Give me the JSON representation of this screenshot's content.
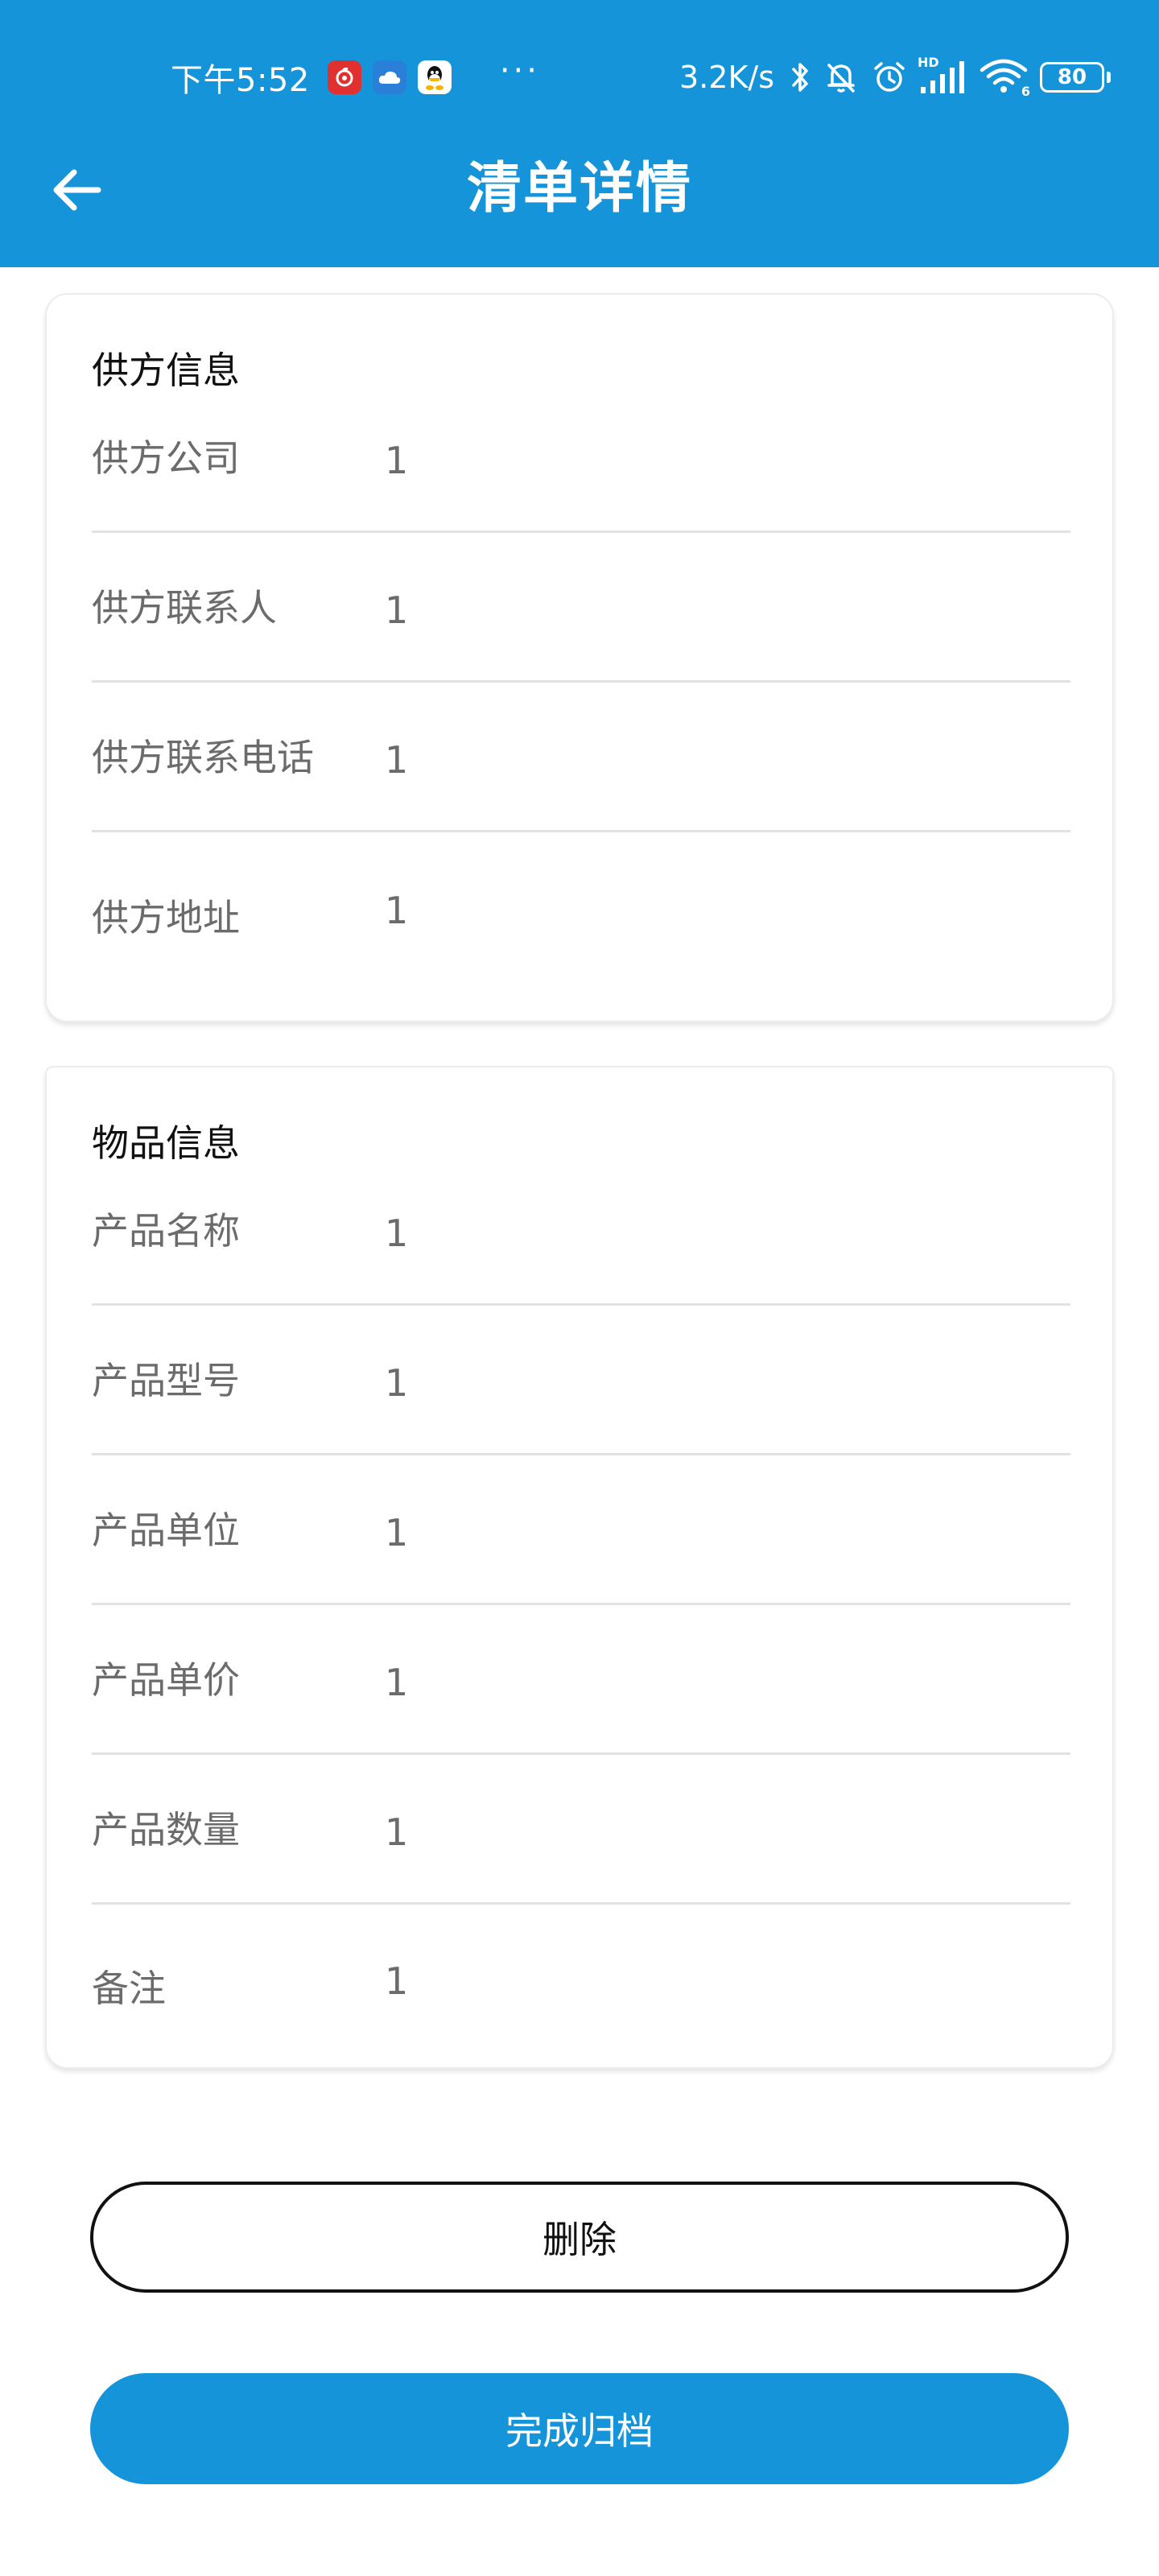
{
  "status_bar": {
    "time": "下午5:52",
    "network_speed": "3.2K/s",
    "battery_level": "80",
    "signal_label": "HD",
    "wifi_label": "6",
    "icons": [
      "netease-music-icon",
      "cloud-icon",
      "qq-icon",
      "bluetooth-icon",
      "bell-off-icon",
      "alarm-icon",
      "signal-icon",
      "wifi-icon",
      "battery-icon"
    ],
    "more_indicator": "···"
  },
  "app_bar": {
    "title": "清单详情",
    "back_icon": "arrow-left-icon"
  },
  "supplier_section": {
    "title": "供方信息",
    "rows": [
      {
        "label": "供方公司",
        "value": "1"
      },
      {
        "label": "供方联系人",
        "value": "1"
      },
      {
        "label": "供方联系电话",
        "value": "1"
      },
      {
        "label": "供方地址",
        "value": "1"
      }
    ]
  },
  "item_section": {
    "title": "物品信息",
    "rows": [
      {
        "label": "产品名称",
        "value": "1"
      },
      {
        "label": "产品型号",
        "value": "1"
      },
      {
        "label": "产品单位",
        "value": "1"
      },
      {
        "label": "产品单价",
        "value": "1"
      },
      {
        "label": "产品数量",
        "value": "1"
      },
      {
        "label": "备注",
        "value": "1"
      }
    ]
  },
  "actions": {
    "delete_label": "删除",
    "archive_label": "完成归档"
  },
  "colors": {
    "primary": "#1594d9",
    "text_dark": "#111111",
    "text_muted": "#6b6b6b",
    "divider": "#e2e2e2"
  }
}
